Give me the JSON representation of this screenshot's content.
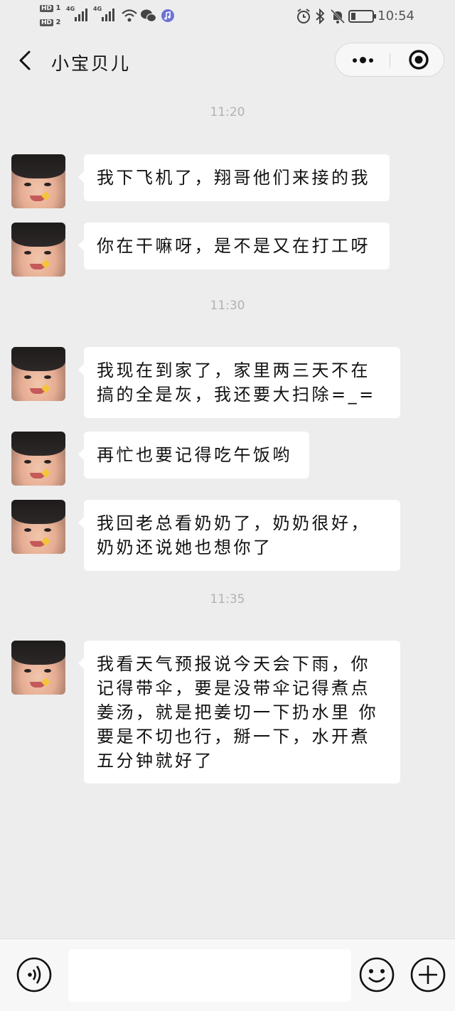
{
  "status_bar": {
    "sim1": "HD",
    "sim1_num": "1",
    "sim2": "HD",
    "sim2_num": "2",
    "net1": "4G",
    "net2": "4G",
    "time": "10:54"
  },
  "header": {
    "title": "小宝贝儿"
  },
  "messages": [
    {
      "time": "11:20"
    },
    {
      "text": "我下飞机了，翔哥他们来接的我"
    },
    {
      "text": "你在干嘛呀，是不是又在打工呀"
    },
    {
      "time": "11:30"
    },
    {
      "text": "我现在到家了，家里两三天不在\n搞的全是灰，我还要大扫除=_="
    },
    {
      "text": "再忙也要记得吃午饭哟"
    },
    {
      "text": "我回老总看奶奶了，奶奶很好，\n奶奶还说她也想你了"
    },
    {
      "time": "11:35"
    },
    {
      "text": "我看天气预报说今天会下雨，你\n记得带伞，要是没带伞记得煮点\n姜汤，就是把姜切一下扔水里 你\n要是不切也行，掰一下，水开煮\n五分钟就好了"
    }
  ],
  "input_bar": {
    "value": ""
  },
  "icons": {
    "back": "chevron-left-icon",
    "more": "more-dots-icon",
    "close": "target-circle-icon",
    "voice": "voice-icon",
    "emoji": "emoji-icon",
    "plus": "plus-icon"
  }
}
